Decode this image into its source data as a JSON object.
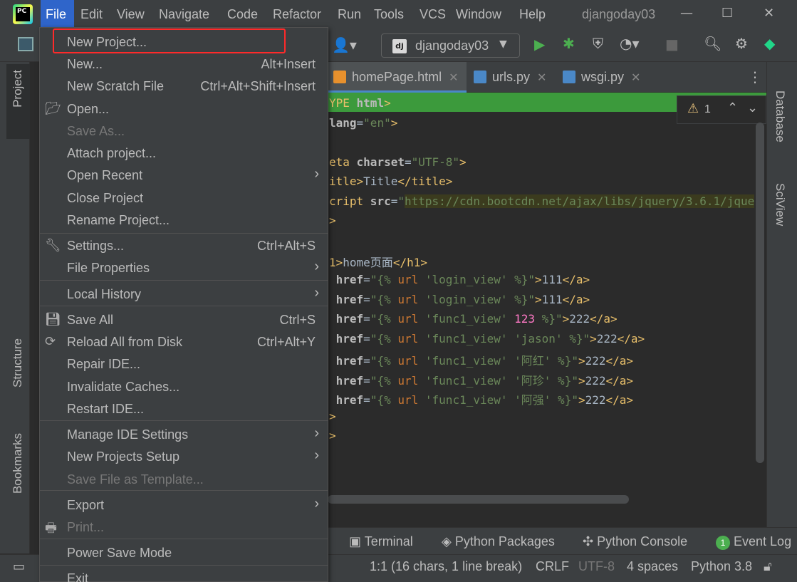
{
  "titlebar": {
    "menus": [
      "File",
      "Edit",
      "View",
      "Navigate",
      "Code",
      "Refactor",
      "Run",
      "Tools",
      "VCS",
      "Window",
      "Help"
    ],
    "window_title": "djangoday03",
    "minimize": "—",
    "maximize": "☐",
    "close": "✕"
  },
  "toolbar": {
    "run_config": "djangoday03",
    "run_config_badge": "dj"
  },
  "left_stripe": {
    "project": "Project",
    "structure": "Structure",
    "bookmarks": "Bookmarks"
  },
  "right_stripe": {
    "database": "Database",
    "sciview": "SciView"
  },
  "tabs": [
    {
      "label": "homePage.html"
    },
    {
      "label": "urls.py"
    },
    {
      "label": "wsgi.py"
    }
  ],
  "inspection": {
    "warnings": "1"
  },
  "file_menu": {
    "items": [
      {
        "label": "New Project...",
        "shortcut": ""
      },
      {
        "label": "New...",
        "shortcut": "Alt+Insert"
      },
      {
        "label": "New Scratch File",
        "shortcut": "Ctrl+Alt+Shift+Insert"
      },
      {
        "label": "Open...",
        "shortcut": ""
      },
      {
        "label": "Save As...",
        "shortcut": ""
      },
      {
        "label": "Attach project...",
        "shortcut": ""
      },
      {
        "label": "Open Recent",
        "shortcut": ""
      },
      {
        "label": "Close Project",
        "shortcut": ""
      },
      {
        "label": "Rename Project...",
        "shortcut": ""
      },
      {
        "label": "Settings...",
        "shortcut": "Ctrl+Alt+S"
      },
      {
        "label": "File Properties",
        "shortcut": ""
      },
      {
        "label": "Local History",
        "shortcut": ""
      },
      {
        "label": "Save All",
        "shortcut": "Ctrl+S"
      },
      {
        "label": "Reload All from Disk",
        "shortcut": "Ctrl+Alt+Y"
      },
      {
        "label": "Repair IDE...",
        "shortcut": ""
      },
      {
        "label": "Invalidate Caches...",
        "shortcut": ""
      },
      {
        "label": "Restart IDE...",
        "shortcut": ""
      },
      {
        "label": "Manage IDE Settings",
        "shortcut": ""
      },
      {
        "label": "New Projects Setup",
        "shortcut": ""
      },
      {
        "label": "Save File as Template...",
        "shortcut": ""
      },
      {
        "label": "Export",
        "shortcut": ""
      },
      {
        "label": "Print...",
        "shortcut": ""
      },
      {
        "label": "Power Save Mode",
        "shortcut": ""
      },
      {
        "label": "Exit",
        "shortcut": ""
      }
    ]
  },
  "code": {
    "l1": [
      "YPE",
      " html",
      ">"
    ],
    "l2": [
      "lang",
      "=",
      "\"en\"",
      ">"
    ],
    "l4": [
      "eta",
      " charset",
      "=",
      "\"UTF-8\"",
      ">"
    ],
    "l5": [
      "itle>",
      "Title",
      "</title>"
    ],
    "l6": [
      "cript",
      " src",
      "=",
      "\"",
      "https://cdn.bootcdn.net/ajax/libs/jquery/3.6.1/jque"
    ],
    "l7": [
      ">"
    ],
    "l9": [
      "1>",
      "home页面",
      "</h1>"
    ],
    "links": [
      {
        "arg": "'login_view'",
        "extra": "",
        "text": "111"
      },
      {
        "arg": "'login_view'",
        "extra": "",
        "text": "111"
      },
      {
        "arg": "'func1_view'",
        "extra": "123",
        "text": "222"
      },
      {
        "arg": "'func1_view'",
        "extra": "'jason'",
        "text": "222"
      },
      {
        "arg": "'func1_view'",
        "extra": "'阿红'",
        "text": "222"
      },
      {
        "arg": "'func1_view'",
        "extra": "'阿珍'",
        "text": "222"
      },
      {
        "arg": "'func1_view'",
        "extra": "'阿强'",
        "text": "222"
      }
    ],
    "close1": ">",
    "close2": ">"
  },
  "bottom_tools": [
    "Terminal",
    "Python Packages",
    "Python Console",
    "Event Log"
  ],
  "event_log_count": "1",
  "status": {
    "position": "1:1 (16 chars, 1 line break)",
    "line_sep": "CRLF",
    "encoding": "UTF-8",
    "indent": "4 spaces",
    "interpreter": "Python 3.8"
  },
  "colors": {
    "accent": "#2f65ca",
    "highlight_box": "#ff2a2a",
    "green_bar": "#3c9a3c"
  }
}
